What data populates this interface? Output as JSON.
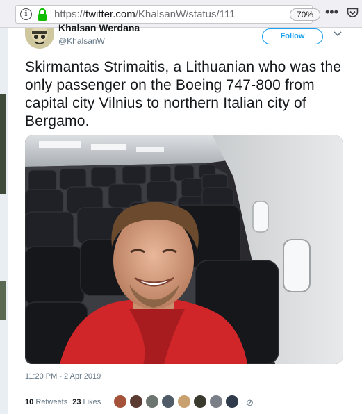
{
  "browser": {
    "info_icon": "info-icon",
    "lock_icon": "lock-icon",
    "url_prefix": "https://",
    "url_domain": "twitter.com",
    "url_path": "/KhalsanW/status/111",
    "zoom": "70%",
    "more_icon": "more-icon",
    "pocket_icon": "pocket-icon"
  },
  "tweet": {
    "display_name": "Khalsan Werdana",
    "handle": "@KhalsanW",
    "follow_label": "Follow",
    "caret_icon": "chevron-down-icon",
    "text": "Skirmantas Strimaitis, a Lithuanian who was the only passenger on the Boeing 747-800 from capital city Vilnius to northern Italian city of Bergamo.",
    "timestamp": "11:20 PM - 2 Apr 2019",
    "retweets_count": "10",
    "retweets_label": "Retweets",
    "likes_count": "23",
    "likes_label": "Likes",
    "likers": [
      "liker-1",
      "liker-2",
      "liker-3",
      "liker-4",
      "liker-5",
      "liker-6",
      "liker-7",
      "liker-8"
    ],
    "colors": {
      "accent": "#1da1f2",
      "text": "#14171a",
      "muted": "#657786"
    }
  }
}
